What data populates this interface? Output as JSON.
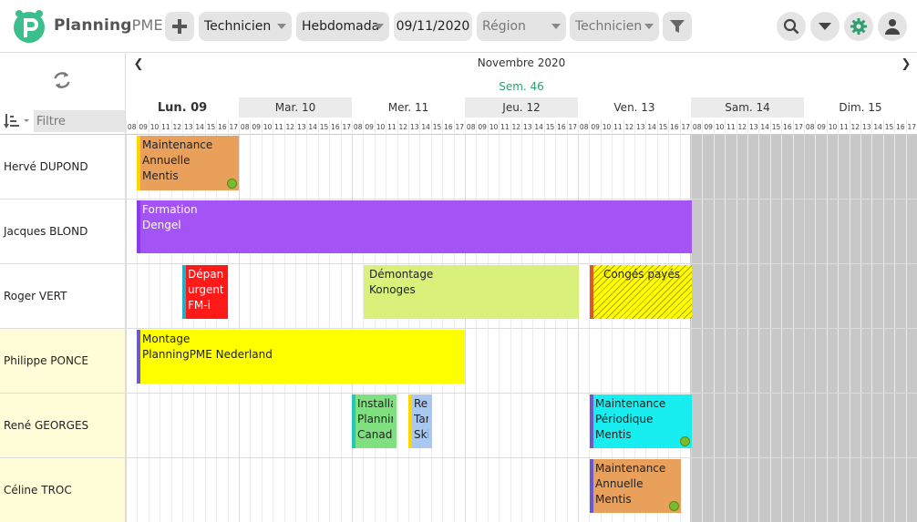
{
  "app": {
    "logo_text_main": "Planning",
    "logo_text_pme": "PME"
  },
  "toolbar": {
    "resource_type": "Technicien",
    "view_mode": "Hebdomadaire",
    "date": "09/11/2020",
    "region_placeholder": "Région",
    "technician_placeholder": "Technicien"
  },
  "left": {
    "filter_placeholder": "Filtre"
  },
  "timeline": {
    "month": "Novembre 2020",
    "week": "Sem. 46",
    "days": [
      "Lun. 09",
      "Mar. 10",
      "Mer. 11",
      "Jeu. 12",
      "Ven. 13",
      "Sam. 14",
      "Dim. 15"
    ],
    "hours": [
      "08",
      "09",
      "10",
      "11",
      "12",
      "13",
      "14",
      "15",
      "16",
      "17"
    ]
  },
  "resources": [
    "Hervé DUPOND",
    "Jacques BLOND",
    "Roger VERT",
    "Philippe PONCE",
    "René GEORGES",
    "Céline TROC"
  ],
  "events": [
    {
      "row": 0,
      "lines": [
        "Maintenance",
        "Annuelle",
        "Mentis"
      ],
      "color": "#e8a05a",
      "bar": "#ffd600",
      "text": "#222",
      "smile": true
    },
    {
      "row": 1,
      "lines": [
        "Formation",
        "Dengel"
      ],
      "color": "#a453f5",
      "bar": "#8c39e8",
      "text": "#ffffff",
      "smile": false
    },
    {
      "row": 2,
      "lines": [
        "Dépannage",
        "urgent",
        "FM-i"
      ],
      "color": "#ff1a1a",
      "bar": "#22b0c8",
      "text": "#ffffff",
      "smile": false
    },
    {
      "row": 2,
      "lines": [
        "Démontage",
        "Konoges"
      ],
      "color": "#d9f07a",
      "bar": "#d9f07a",
      "text": "#222",
      "smile": false
    },
    {
      "row": 2,
      "lines": [
        "Congés payés"
      ],
      "color": "#ffff00",
      "bar": "#e05a1a",
      "text": "#222",
      "smile": false,
      "hatched": true
    },
    {
      "row": 3,
      "lines": [
        "Montage",
        "PlanningPME Nederland"
      ],
      "color": "#ffff00",
      "bar": "#6a5acd",
      "text": "#222",
      "smile": false
    },
    {
      "row": 4,
      "lines": [
        "Installation",
        "Planning",
        "Canada"
      ],
      "color": "#7ee07e",
      "bar": "#22c8b8",
      "text": "#222",
      "smile": false
    },
    {
      "row": 4,
      "lines": [
        "Rendez-vous",
        "Tarif",
        "Skill"
      ],
      "color": "#a8c8f0",
      "bar": "#ffd600",
      "text": "#222",
      "smile": false
    },
    {
      "row": 4,
      "lines": [
        "Maintenance",
        "Périodique",
        "Mentis"
      ],
      "color": "#18eef0",
      "bar": "#6a5acd",
      "text": "#222",
      "smile": true
    },
    {
      "row": 5,
      "lines": [
        "Maintenance",
        "Annuelle",
        "Mentis"
      ],
      "color": "#e8a05a",
      "bar": "#6a5acd",
      "text": "#222",
      "smile": true
    }
  ]
}
